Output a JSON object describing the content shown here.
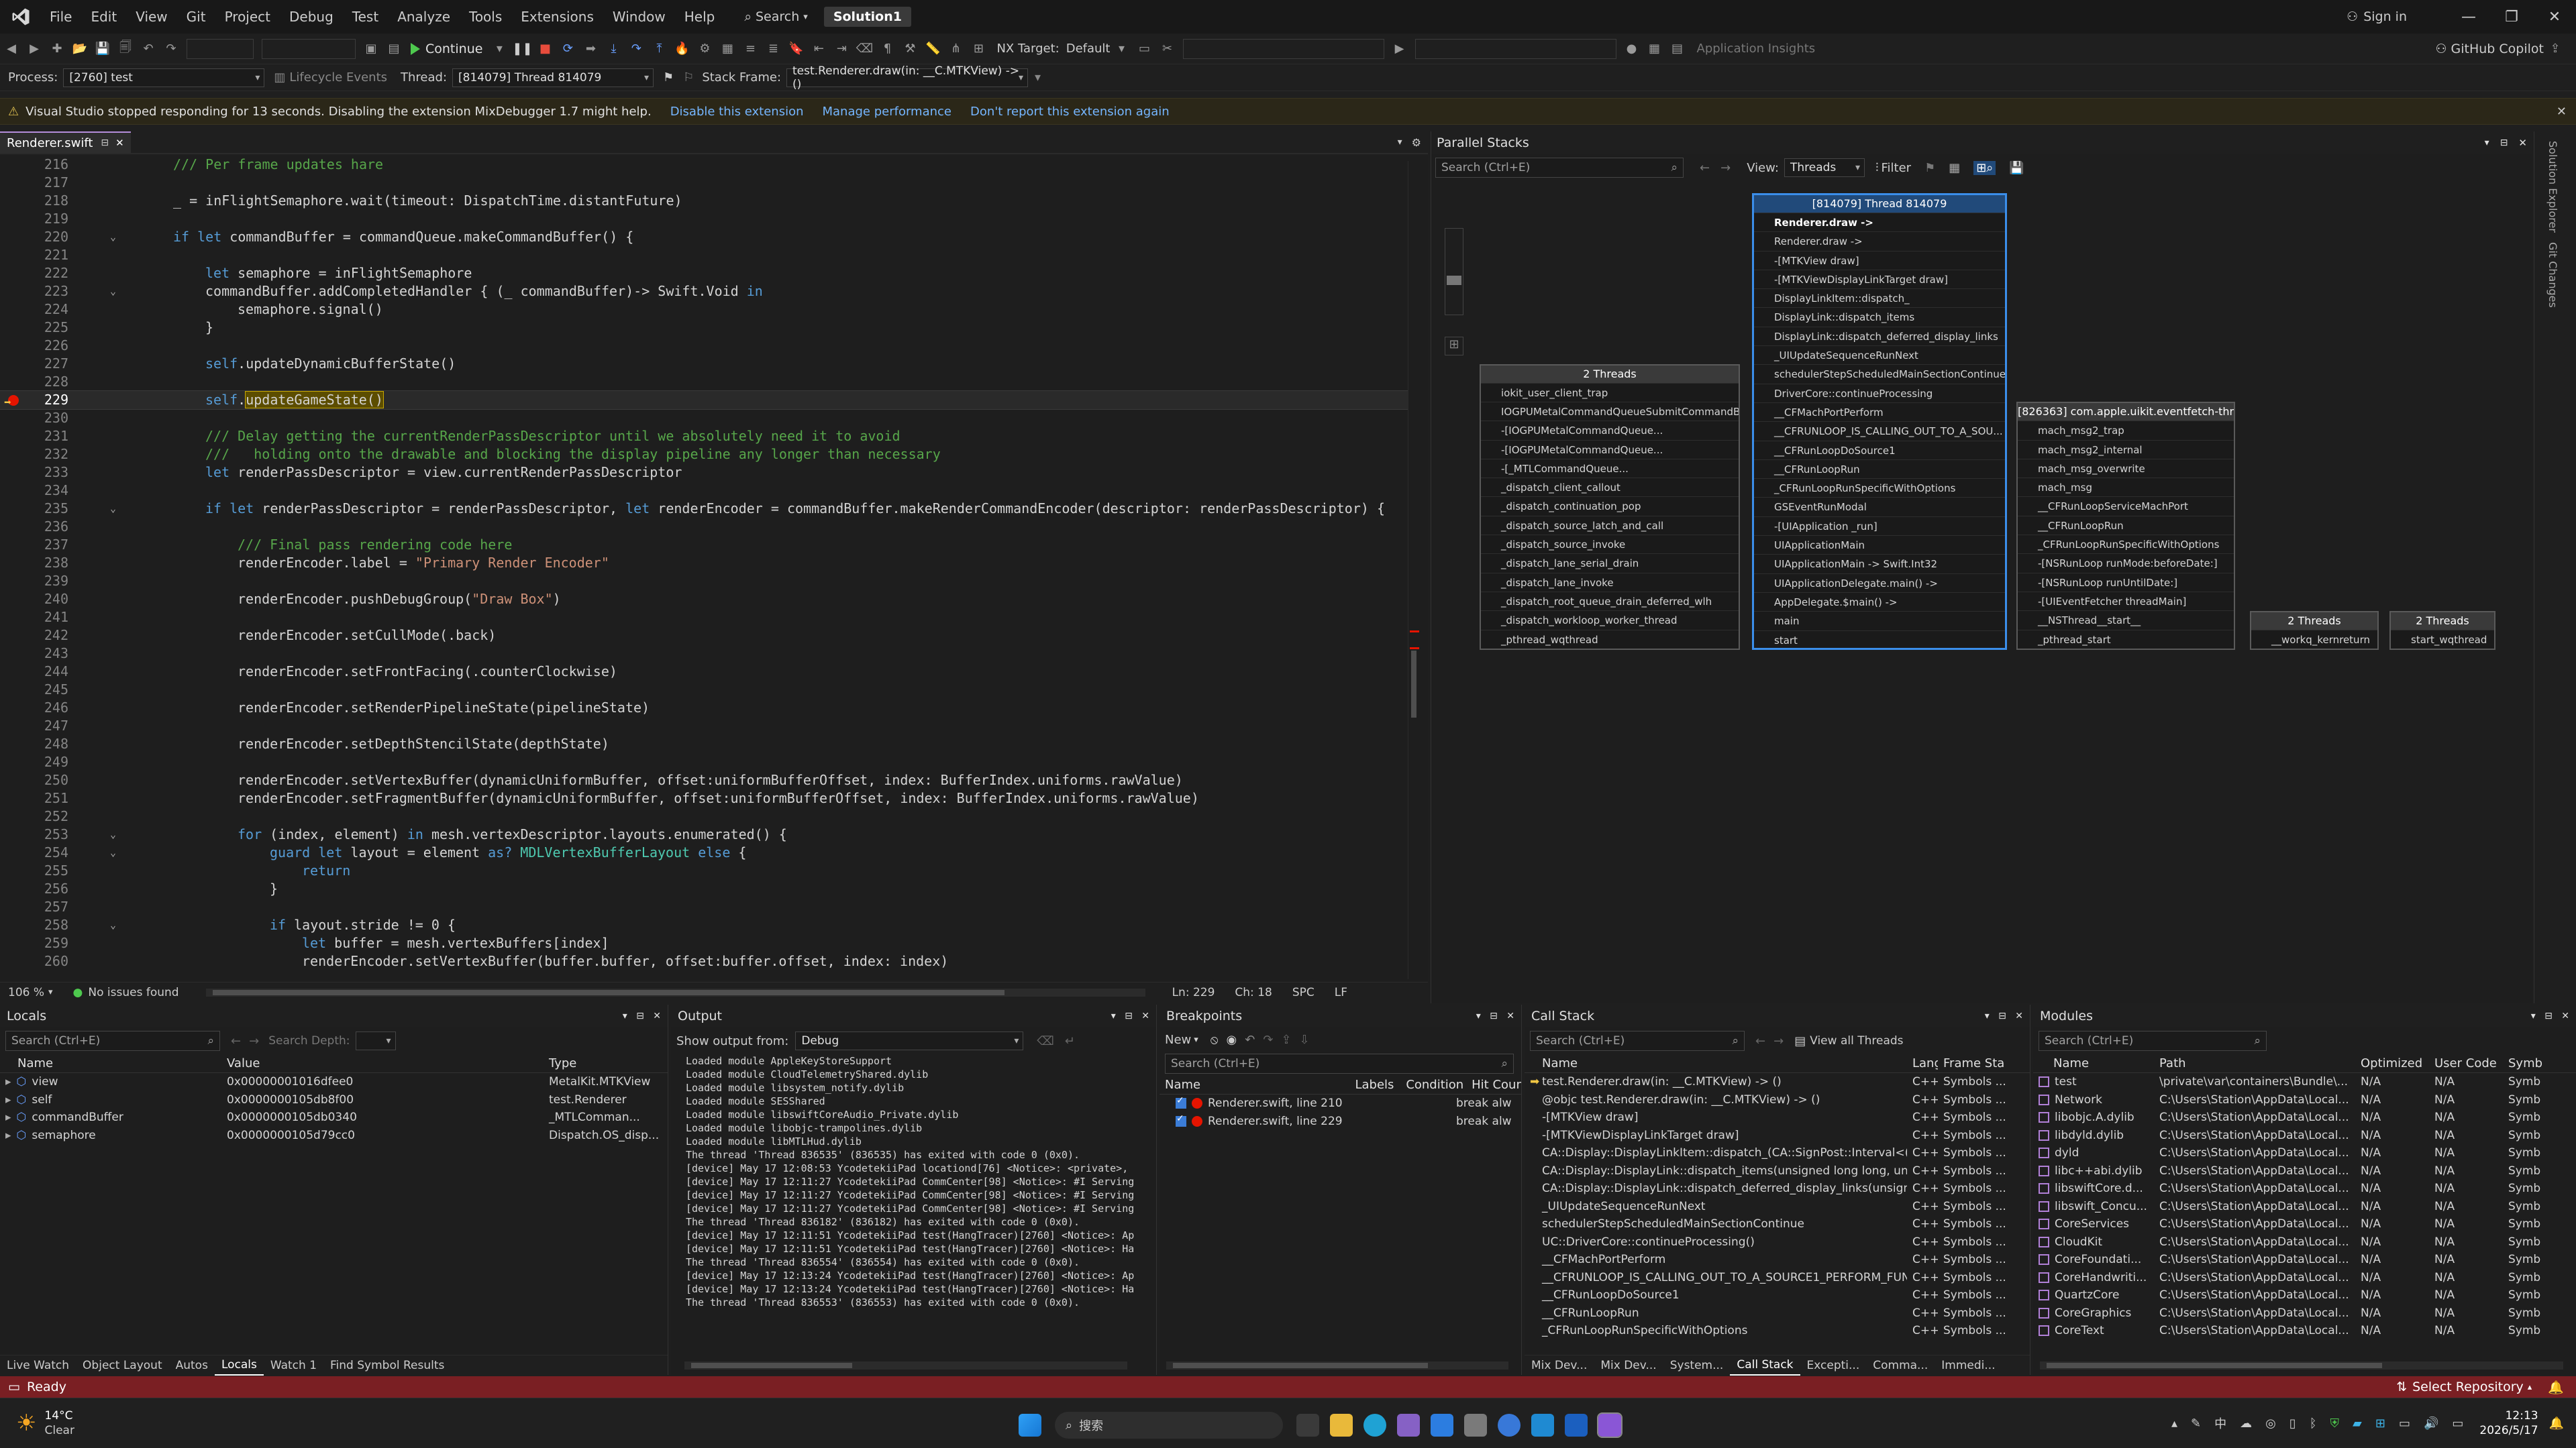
{
  "menu": [
    "File",
    "Edit",
    "View",
    "Git",
    "Project",
    "Debug",
    "Test",
    "Analyze",
    "Tools",
    "Extensions",
    "Window",
    "Help"
  ],
  "search_label": "Search",
  "solution": "Solution1",
  "signin": "Sign in",
  "toolbar": {
    "continue": "Continue",
    "nx_target_label": "NX Target:",
    "nx_target_value": "Default",
    "app_insights": "Application Insights",
    "copilot": "GitHub Copilot"
  },
  "debugbar": {
    "process_label": "Process:",
    "process": "[2760] test",
    "lifecycle": "Lifecycle Events",
    "thread_label": "Thread:",
    "thread": "[814079] Thread 814079",
    "stackframe_label": "Stack Frame:",
    "stackframe": "test.Renderer.draw(in: __C.MTKView) -> ()"
  },
  "infobar": {
    "message": "Visual Studio stopped responding for 13 seconds. Disabling the extension MixDebugger 1.7 might help.",
    "links": [
      "Disable this extension",
      "Manage performance",
      "Don't report this extension again"
    ]
  },
  "editor": {
    "tab": "Renderer.swift",
    "lines": [
      {
        "n": "216",
        "html": "<span class='c'>/// Per frame updates hare</span>",
        "indent": 1
      },
      {
        "n": "217",
        "html": "",
        "indent": 0
      },
      {
        "n": "218",
        "html": "_ = inFlightSemaphore.wait(timeout: DispatchTime.distantFuture)",
        "indent": 1
      },
      {
        "n": "219",
        "html": "",
        "indent": 0
      },
      {
        "n": "220",
        "html": "<span class='k'>if let</span> commandBuffer = commandQueue.makeCommandBuffer() {",
        "indent": 1,
        "fold": true
      },
      {
        "n": "221",
        "html": "",
        "indent": 0
      },
      {
        "n": "222",
        "html": "<span class='k'>let</span> semaphore = inFlightSemaphore",
        "indent": 2
      },
      {
        "n": "223",
        "html": "commandBuffer.addCompletedHandler { (_ commandBuffer)-> Swift.Void <span class='k'>in</span>",
        "indent": 2,
        "fold": true
      },
      {
        "n": "224",
        "html": "semaphore.signal()",
        "indent": 3
      },
      {
        "n": "225",
        "html": "}",
        "indent": 2
      },
      {
        "n": "226",
        "html": "",
        "indent": 0
      },
      {
        "n": "227",
        "html": "<span class='k'>self</span>.updateDynamicBufferState()",
        "indent": 2
      },
      {
        "n": "228",
        "html": "",
        "indent": 0
      },
      {
        "n": "229",
        "html": "<span class='k'>self</span>.<span class='sel'>updateGameState()</span>",
        "indent": 2,
        "current": true
      },
      {
        "n": "230",
        "html": "",
        "indent": 0
      },
      {
        "n": "231",
        "html": "<span class='c'>/// Delay getting the currentRenderPassDescriptor until we absolutely need it to avoid</span>",
        "indent": 2
      },
      {
        "n": "232",
        "html": "<span class='c'>///   holding onto the drawable and blocking the display pipeline any longer than necessary</span>",
        "indent": 2
      },
      {
        "n": "233",
        "html": "<span class='k'>let</span> renderPassDescriptor = view.currentRenderPassDescriptor",
        "indent": 2
      },
      {
        "n": "234",
        "html": "",
        "indent": 0
      },
      {
        "n": "235",
        "html": "<span class='k'>if let</span> renderPassDescriptor = renderPassDescriptor, <span class='k'>let</span> renderEncoder = commandBuffer.makeRenderCommandEncoder(descriptor: renderPassDescriptor) {",
        "indent": 2,
        "fold": true
      },
      {
        "n": "236",
        "html": "",
        "indent": 0
      },
      {
        "n": "237",
        "html": "<span class='c'>/// Final pass rendering code here</span>",
        "indent": 3
      },
      {
        "n": "238",
        "html": "renderEncoder.label = <span class='s'>\"Primary Render Encoder\"</span>",
        "indent": 3
      },
      {
        "n": "239",
        "html": "",
        "indent": 0
      },
      {
        "n": "240",
        "html": "renderEncoder.pushDebugGroup(<span class='s'>\"Draw Box\"</span>)",
        "indent": 3
      },
      {
        "n": "241",
        "html": "",
        "indent": 0
      },
      {
        "n": "242",
        "html": "renderEncoder.setCullMode(.back)",
        "indent": 3
      },
      {
        "n": "243",
        "html": "",
        "indent": 0
      },
      {
        "n": "244",
        "html": "renderEncoder.setFrontFacing(.counterClockwise)",
        "indent": 3
      },
      {
        "n": "245",
        "html": "",
        "indent": 0
      },
      {
        "n": "246",
        "html": "renderEncoder.setRenderPipelineState(pipelineState)",
        "indent": 3
      },
      {
        "n": "247",
        "html": "",
        "indent": 0
      },
      {
        "n": "248",
        "html": "renderEncoder.setDepthStencilState(depthState)",
        "indent": 3
      },
      {
        "n": "249",
        "html": "",
        "indent": 0
      },
      {
        "n": "250",
        "html": "renderEncoder.setVertexBuffer(dynamicUniformBuffer, offset:uniformBufferOffset, index: BufferIndex.uniforms.rawValue)",
        "indent": 3
      },
      {
        "n": "251",
        "html": "renderEncoder.setFragmentBuffer(dynamicUniformBuffer, offset:uniformBufferOffset, index: BufferIndex.uniforms.rawValue)",
        "indent": 3
      },
      {
        "n": "252",
        "html": "",
        "indent": 0
      },
      {
        "n": "253",
        "html": "<span class='k'>for</span> (index, element) <span class='k'>in</span> mesh.vertexDescriptor.layouts.enumerated() {",
        "indent": 3,
        "fold": true
      },
      {
        "n": "254",
        "html": "<span class='k'>guard let</span> layout = element <span class='k'>as?</span> <span class='t'>MDLVertexBufferLayout</span> <span class='k'>else</span> {",
        "indent": 4,
        "fold": true
      },
      {
        "n": "255",
        "html": "<span class='k'>return</span>",
        "indent": 5
      },
      {
        "n": "256",
        "html": "}",
        "indent": 4
      },
      {
        "n": "257",
        "html": "",
        "indent": 0
      },
      {
        "n": "258",
        "html": "<span class='k'>if</span> layout.stride != 0 {",
        "indent": 4,
        "fold": true
      },
      {
        "n": "259",
        "html": "<span class='k'>let</span> buffer = mesh.vertexBuffers[index]",
        "indent": 5
      },
      {
        "n": "260",
        "html": "renderEncoder.setVertexBuffer(buffer.buffer, offset:buffer.offset, index: index)",
        "indent": 5
      }
    ],
    "zoom": "106 %",
    "issues": "No issues found",
    "ln": "Ln: 229",
    "ch": "Ch: 18",
    "spc": "SPC",
    "lf": "LF"
  },
  "parallel_stacks": {
    "title": "Parallel Stacks",
    "search_placeholder": "Search (Ctrl+E)",
    "view_label": "View:",
    "view_value": "Threads",
    "filter": "Filter",
    "nodes": [
      {
        "id": "main",
        "header": "[814079] Thread 814079",
        "active": true,
        "frames": [
          "Renderer.draw ->",
          "Renderer.draw ->",
          "-[MTKView draw]",
          "-[MTKViewDisplayLinkTarget draw]",
          "DisplayLinkItem::dispatch_",
          "DisplayLink::dispatch_items",
          "DisplayLink::dispatch_deferred_display_links",
          "_UIUpdateSequenceRunNext",
          "schedulerStepScheduledMainSectionContinue",
          "DriverCore::continueProcessing",
          "__CFMachPortPerform",
          "__CFRUNLOOP_IS_CALLING_OUT_TO_A_SOU...",
          "__CFRunLoopDoSource1",
          "__CFRunLoopRun",
          "_CFRunLoopRunSpecificWithOptions",
          "GSEventRunModal",
          "-[UIApplication _run]",
          "UIApplicationMain",
          "UIApplicationMain -> Swift.Int32",
          "UIApplicationDelegate.main() ->",
          "AppDelegate.$main() ->",
          "main",
          "start"
        ]
      },
      {
        "id": "two",
        "header": "2 Threads",
        "frames": [
          "iokit_user_client_trap",
          "IOGPUMetalCommandQueueSubmitCommandBuff...",
          "-[IOGPUMetalCommandQueue...",
          "-[IOGPUMetalCommandQueue...",
          "-[_MTLCommandQueue...",
          "_dispatch_client_callout",
          "_dispatch_continuation_pop",
          "_dispatch_source_latch_and_call",
          "_dispatch_source_invoke",
          "_dispatch_lane_serial_drain",
          "_dispatch_lane_invoke",
          "_dispatch_root_queue_drain_deferred_wlh",
          "_dispatch_workloop_worker_thread",
          "_pthread_wqthread"
        ]
      },
      {
        "id": "event",
        "header": "[826363] com.apple.uikit.eventfetch-thread",
        "frames": [
          "mach_msg2_trap",
          "mach_msg2_internal",
          "mach_msg_overwrite",
          "mach_msg",
          "__CFRunLoopServiceMachPort",
          "__CFRunLoopRun",
          "_CFRunLoopRunSpecificWithOptions",
          "-[NSRunLoop runMode:beforeDate:]",
          "-[NSRunLoop runUntilDate:]",
          "-[UIEventFetcher threadMain]",
          "__NSThread__start__",
          "_pthread_start"
        ]
      },
      {
        "id": "kev",
        "header": "2 Threads",
        "frames": [
          "__workq_kernreturn"
        ]
      },
      {
        "id": "wq",
        "header": "2 Threads",
        "frames": [
          "start_wqthread"
        ]
      }
    ]
  },
  "locals": {
    "title": "Locals",
    "search_placeholder": "Search (Ctrl+E)",
    "depth_label": "Search Depth:",
    "cols": [
      "Name",
      "Value",
      "Type"
    ],
    "rows": [
      {
        "name": "view",
        "value": "0x00000001016dfee0",
        "type": "MetalKit.MTKView"
      },
      {
        "name": "self",
        "value": "0x0000000105db8f00",
        "type": "test.Renderer"
      },
      {
        "name": "commandBuffer",
        "value": "0x0000000105db0340",
        "type": "_MTLComman..."
      },
      {
        "name": "semaphore",
        "value": "0x0000000105d79cc0",
        "type": "Dispatch.OS_disp..."
      }
    ],
    "tabs": [
      "Live Watch",
      "Object Layout",
      "Autos",
      "Locals",
      "Watch 1",
      "Find Symbol Results"
    ]
  },
  "output": {
    "title": "Output",
    "show_label": "Show output from:",
    "source": "Debug",
    "lines": [
      "Loaded module AppleKeyStoreSupport",
      "Loaded module CloudTelemetryShared.dylib",
      "Loaded module libsystem_notify.dylib",
      "Loaded module SESShared",
      "Loaded module libswiftCoreAudio_Private.dylib",
      "Loaded module libobjc-trampolines.dylib",
      "Loaded module libMTLHud.dylib",
      "The thread 'Thread 836535' (836535) has exited with code 0 (0x0).",
      "[device] May 17 12:08:53 YcodetekiiPad locationd[76] <Notice>: <private>,",
      "[device] May 17 12:11:27 YcodetekiiPad CommCenter[98] <Notice>: #I Serving",
      "[device] May 17 12:11:27 YcodetekiiPad CommCenter[98] <Notice>: #I Serving",
      "[device] May 17 12:11:27 YcodetekiiPad CommCenter[98] <Notice>: #I Serving",
      "The thread 'Thread 836182' (836182) has exited with code 0 (0x0).",
      "[device] May 17 12:11:51 YcodetekiiPad test(HangTracer)[2760] <Notice>: Ap",
      "[device] May 17 12:11:51 YcodetekiiPad test(HangTracer)[2760] <Notice>: Ha",
      "The thread 'Thread 836554' (836554) has exited with code 0 (0x0).",
      "[device] May 17 12:13:24 YcodetekiiPad test(HangTracer)[2760] <Notice>: Ap",
      "[device] May 17 12:13:24 YcodetekiiPad test(HangTracer)[2760] <Notice>: Ha",
      "The thread 'Thread 836553' (836553) has exited with code 0 (0x0)."
    ]
  },
  "breakpoints": {
    "title": "Breakpoints",
    "new": "New",
    "search_placeholder": "Search (Ctrl+E)",
    "cols": [
      "Name",
      "Labels",
      "Condition",
      "Hit Count"
    ],
    "rows": [
      {
        "name": "Renderer.swift, line 210",
        "hit": "break alw"
      },
      {
        "name": "Renderer.swift, line 229",
        "hit": "break alw"
      }
    ]
  },
  "callstack": {
    "title": "Call Stack",
    "search_placeholder": "Search (Ctrl+E)",
    "view_all": "View all Threads",
    "cols": [
      "Name",
      "Lang",
      "Frame Sta"
    ],
    "rows": [
      {
        "name": "test.Renderer.draw(in: __C.MTKView) -> ()",
        "lang": "C++",
        "fs": "Symbols ..."
      },
      {
        "name": "@objc test.Renderer.draw(in: __C.MTKView) -> ()",
        "lang": "C++",
        "fs": "Symbols ..."
      },
      {
        "name": "-[MTKView draw]",
        "lang": "C++",
        "fs": "Symbols ..."
      },
      {
        "name": "-[MTKViewDisplayLinkTarget draw]",
        "lang": "C++",
        "fs": "Symbols ..."
      },
      {
        "name": "CA::Display::DisplayLinkItem::dispatch_(CA::SignPost::Interval<(CA::...",
        "lang": "C++",
        "fs": "Symbols ..."
      },
      {
        "name": "CA::Display::DisplayLink::dispatch_items(unsigned long long, unsig...",
        "lang": "C++",
        "fs": "Symbols ..."
      },
      {
        "name": "CA::Display::DisplayLink::dispatch_deferred_display_links(unsigned i...",
        "lang": "C++",
        "fs": "Symbols ..."
      },
      {
        "name": "_UIUpdateSequenceRunNext",
        "lang": "C++",
        "fs": "Symbols ..."
      },
      {
        "name": "schedulerStepScheduledMainSectionContinue",
        "lang": "C++",
        "fs": "Symbols ..."
      },
      {
        "name": "UC::DriverCore::continueProcessing()",
        "lang": "C++",
        "fs": "Symbols ..."
      },
      {
        "name": "__CFMachPortPerform",
        "lang": "C++",
        "fs": "Symbols ..."
      },
      {
        "name": "__CFRUNLOOP_IS_CALLING_OUT_TO_A_SOURCE1_PERFORM_FUNC...",
        "lang": "C++",
        "fs": "Symbols ..."
      },
      {
        "name": "__CFRunLoopDoSource1",
        "lang": "C++",
        "fs": "Symbols ..."
      },
      {
        "name": "__CFRunLoopRun",
        "lang": "C++",
        "fs": "Symbols ..."
      },
      {
        "name": "_CFRunLoopRunSpecificWithOptions",
        "lang": "C++",
        "fs": "Symbols ..."
      }
    ],
    "tabs": [
      "Mix Dev...",
      "Mix Dev...",
      "System...",
      "Call Stack",
      "Excepti...",
      "Comma...",
      "Immedi..."
    ]
  },
  "modules": {
    "title": "Modules",
    "search_placeholder": "Search (Ctrl+E)",
    "cols": [
      "Name",
      "Path",
      "Optimized",
      "User Code",
      "Symb"
    ],
    "rows": [
      {
        "name": "test",
        "path": "\\private\\var\\containers\\Bundle\\...",
        "opt": "N/A",
        "uc": "N/A",
        "sym": "Symb"
      },
      {
        "name": "Network",
        "path": "C:\\Users\\Station\\AppData\\Local...",
        "opt": "N/A",
        "uc": "N/A",
        "sym": "Symb"
      },
      {
        "name": "libobjc.A.dylib",
        "path": "C:\\Users\\Station\\AppData\\Local...",
        "opt": "N/A",
        "uc": "N/A",
        "sym": "Symb"
      },
      {
        "name": "libdyld.dylib",
        "path": "C:\\Users\\Station\\AppData\\Local...",
        "opt": "N/A",
        "uc": "N/A",
        "sym": "Symb"
      },
      {
        "name": "dyld",
        "path": "C:\\Users\\Station\\AppData\\Local...",
        "opt": "N/A",
        "uc": "N/A",
        "sym": "Symb"
      },
      {
        "name": "libc++abi.dylib",
        "path": "C:\\Users\\Station\\AppData\\Local...",
        "opt": "N/A",
        "uc": "N/A",
        "sym": "Symb"
      },
      {
        "name": "libswiftCore.d...",
        "path": "C:\\Users\\Station\\AppData\\Local...",
        "opt": "N/A",
        "uc": "N/A",
        "sym": "Symb"
      },
      {
        "name": "libswift_Concu...",
        "path": "C:\\Users\\Station\\AppData\\Local...",
        "opt": "N/A",
        "uc": "N/A",
        "sym": "Symb"
      },
      {
        "name": "CoreServices",
        "path": "C:\\Users\\Station\\AppData\\Local...",
        "opt": "N/A",
        "uc": "N/A",
        "sym": "Symb"
      },
      {
        "name": "CloudKit",
        "path": "C:\\Users\\Station\\AppData\\Local...",
        "opt": "N/A",
        "uc": "N/A",
        "sym": "Symb"
      },
      {
        "name": "CoreFoundati...",
        "path": "C:\\Users\\Station\\AppData\\Local...",
        "opt": "N/A",
        "uc": "N/A",
        "sym": "Symb"
      },
      {
        "name": "CoreHandwriti...",
        "path": "C:\\Users\\Station\\AppData\\Local...",
        "opt": "N/A",
        "uc": "N/A",
        "sym": "Symb"
      },
      {
        "name": "QuartzCore",
        "path": "C:\\Users\\Station\\AppData\\Local...",
        "opt": "N/A",
        "uc": "N/A",
        "sym": "Symb"
      },
      {
        "name": "CoreGraphics",
        "path": "C:\\Users\\Station\\AppData\\Local...",
        "opt": "N/A",
        "uc": "N/A",
        "sym": "Symb"
      },
      {
        "name": "CoreText",
        "path": "C:\\Users\\Station\\AppData\\Local...",
        "opt": "N/A",
        "uc": "N/A",
        "sym": "Symb"
      }
    ]
  },
  "side_rail": [
    "Solution Explorer",
    "Git Changes"
  ],
  "status": {
    "ready": "Ready",
    "repo": "Select Repository"
  },
  "taskbar": {
    "temp": "14°C",
    "weather": "Clear",
    "search": "搜索",
    "time": "12:13",
    "date": "2026/5/17"
  }
}
